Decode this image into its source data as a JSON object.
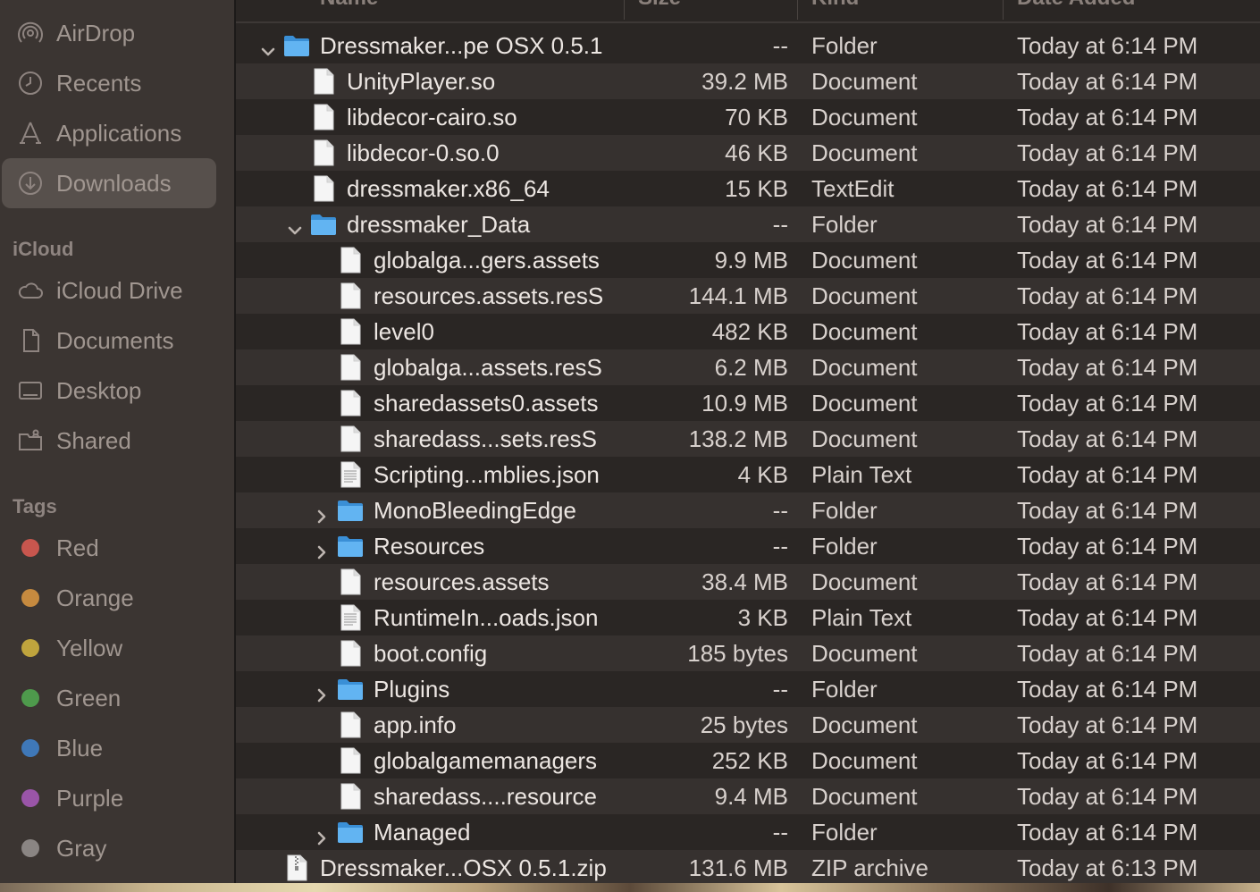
{
  "sidebar": {
    "favorites": [
      {
        "label": "AirDrop",
        "icon": "airdrop-icon"
      },
      {
        "label": "Recents",
        "icon": "clock-icon"
      },
      {
        "label": "Applications",
        "icon": "applications-icon"
      },
      {
        "label": "Downloads",
        "icon": "download-icon",
        "selected": true
      }
    ],
    "icloud_header": "iCloud",
    "icloud": [
      {
        "label": "iCloud Drive",
        "icon": "cloud-icon"
      },
      {
        "label": "Documents",
        "icon": "document-icon"
      },
      {
        "label": "Desktop",
        "icon": "desktop-icon"
      },
      {
        "label": "Shared",
        "icon": "shared-folder-icon"
      }
    ],
    "tags_header": "Tags",
    "tags": [
      {
        "label": "Red",
        "color": "#c8564e"
      },
      {
        "label": "Orange",
        "color": "#c68a3f"
      },
      {
        "label": "Yellow",
        "color": "#bfa43d"
      },
      {
        "label": "Green",
        "color": "#4e9a4c"
      },
      {
        "label": "Blue",
        "color": "#3f78b8"
      },
      {
        "label": "Purple",
        "color": "#9a55a8"
      },
      {
        "label": "Gray",
        "color": "#8a8583"
      }
    ]
  },
  "columns": {
    "name": "Name",
    "size": "Size",
    "kind": "Kind",
    "date": "Date Added"
  },
  "rows": [
    {
      "name": "Dressmaker...pe OSX 0.5.1",
      "size": "--",
      "kind": "Folder",
      "date": "Today at 6:14 PM",
      "level": 0,
      "type": "folder",
      "expanded": true
    },
    {
      "name": "UnityPlayer.so",
      "size": "39.2 MB",
      "kind": "Document",
      "date": "Today at 6:14 PM",
      "level": 1,
      "type": "doc"
    },
    {
      "name": "libdecor-cairo.so",
      "size": "70 KB",
      "kind": "Document",
      "date": "Today at 6:14 PM",
      "level": 1,
      "type": "doc"
    },
    {
      "name": "libdecor-0.so.0",
      "size": "46 KB",
      "kind": "Document",
      "date": "Today at 6:14 PM",
      "level": 1,
      "type": "doc"
    },
    {
      "name": "dressmaker.x86_64",
      "size": "15 KB",
      "kind": "TextEdit",
      "date": "Today at 6:14 PM",
      "level": 1,
      "type": "doc"
    },
    {
      "name": "dressmaker_Data",
      "size": "--",
      "kind": "Folder",
      "date": "Today at 6:14 PM",
      "level": 1,
      "type": "folder",
      "expanded": true
    },
    {
      "name": "globalga...gers.assets",
      "size": "9.9 MB",
      "kind": "Document",
      "date": "Today at 6:14 PM",
      "level": 2,
      "type": "doc"
    },
    {
      "name": "resources.assets.resS",
      "size": "144.1 MB",
      "kind": "Document",
      "date": "Today at 6:14 PM",
      "level": 2,
      "type": "doc"
    },
    {
      "name": "level0",
      "size": "482 KB",
      "kind": "Document",
      "date": "Today at 6:14 PM",
      "level": 2,
      "type": "doc"
    },
    {
      "name": "globalga...assets.resS",
      "size": "6.2 MB",
      "kind": "Document",
      "date": "Today at 6:14 PM",
      "level": 2,
      "type": "doc"
    },
    {
      "name": "sharedassets0.assets",
      "size": "10.9 MB",
      "kind": "Document",
      "date": "Today at 6:14 PM",
      "level": 2,
      "type": "doc"
    },
    {
      "name": "sharedass...sets.resS",
      "size": "138.2 MB",
      "kind": "Document",
      "date": "Today at 6:14 PM",
      "level": 2,
      "type": "doc"
    },
    {
      "name": "Scripting...mblies.json",
      "size": "4 KB",
      "kind": "Plain Text",
      "date": "Today at 6:14 PM",
      "level": 2,
      "type": "text"
    },
    {
      "name": "MonoBleedingEdge",
      "size": "--",
      "kind": "Folder",
      "date": "Today at 6:14 PM",
      "level": 2,
      "type": "folder",
      "expanded": false
    },
    {
      "name": "Resources",
      "size": "--",
      "kind": "Folder",
      "date": "Today at 6:14 PM",
      "level": 2,
      "type": "folder",
      "expanded": false
    },
    {
      "name": "resources.assets",
      "size": "38.4 MB",
      "kind": "Document",
      "date": "Today at 6:14 PM",
      "level": 2,
      "type": "doc"
    },
    {
      "name": "RuntimeIn...oads.json",
      "size": "3 KB",
      "kind": "Plain Text",
      "date": "Today at 6:14 PM",
      "level": 2,
      "type": "text"
    },
    {
      "name": "boot.config",
      "size": "185 bytes",
      "kind": "Document",
      "date": "Today at 6:14 PM",
      "level": 2,
      "type": "doc"
    },
    {
      "name": "Plugins",
      "size": "--",
      "kind": "Folder",
      "date": "Today at 6:14 PM",
      "level": 2,
      "type": "folder",
      "expanded": false
    },
    {
      "name": "app.info",
      "size": "25 bytes",
      "kind": "Document",
      "date": "Today at 6:14 PM",
      "level": 2,
      "type": "doc"
    },
    {
      "name": "globalgamemanagers",
      "size": "252 KB",
      "kind": "Document",
      "date": "Today at 6:14 PM",
      "level": 2,
      "type": "doc"
    },
    {
      "name": "sharedass....resource",
      "size": "9.4 MB",
      "kind": "Document",
      "date": "Today at 6:14 PM",
      "level": 2,
      "type": "doc"
    },
    {
      "name": "Managed",
      "size": "--",
      "kind": "Folder",
      "date": "Today at 6:14 PM",
      "level": 2,
      "type": "folder",
      "expanded": false
    },
    {
      "name": "Dressmaker...OSX 0.5.1.zip",
      "size": "131.6 MB",
      "kind": "ZIP archive",
      "date": "Today at 6:13 PM",
      "level": 0,
      "type": "zip"
    }
  ]
}
